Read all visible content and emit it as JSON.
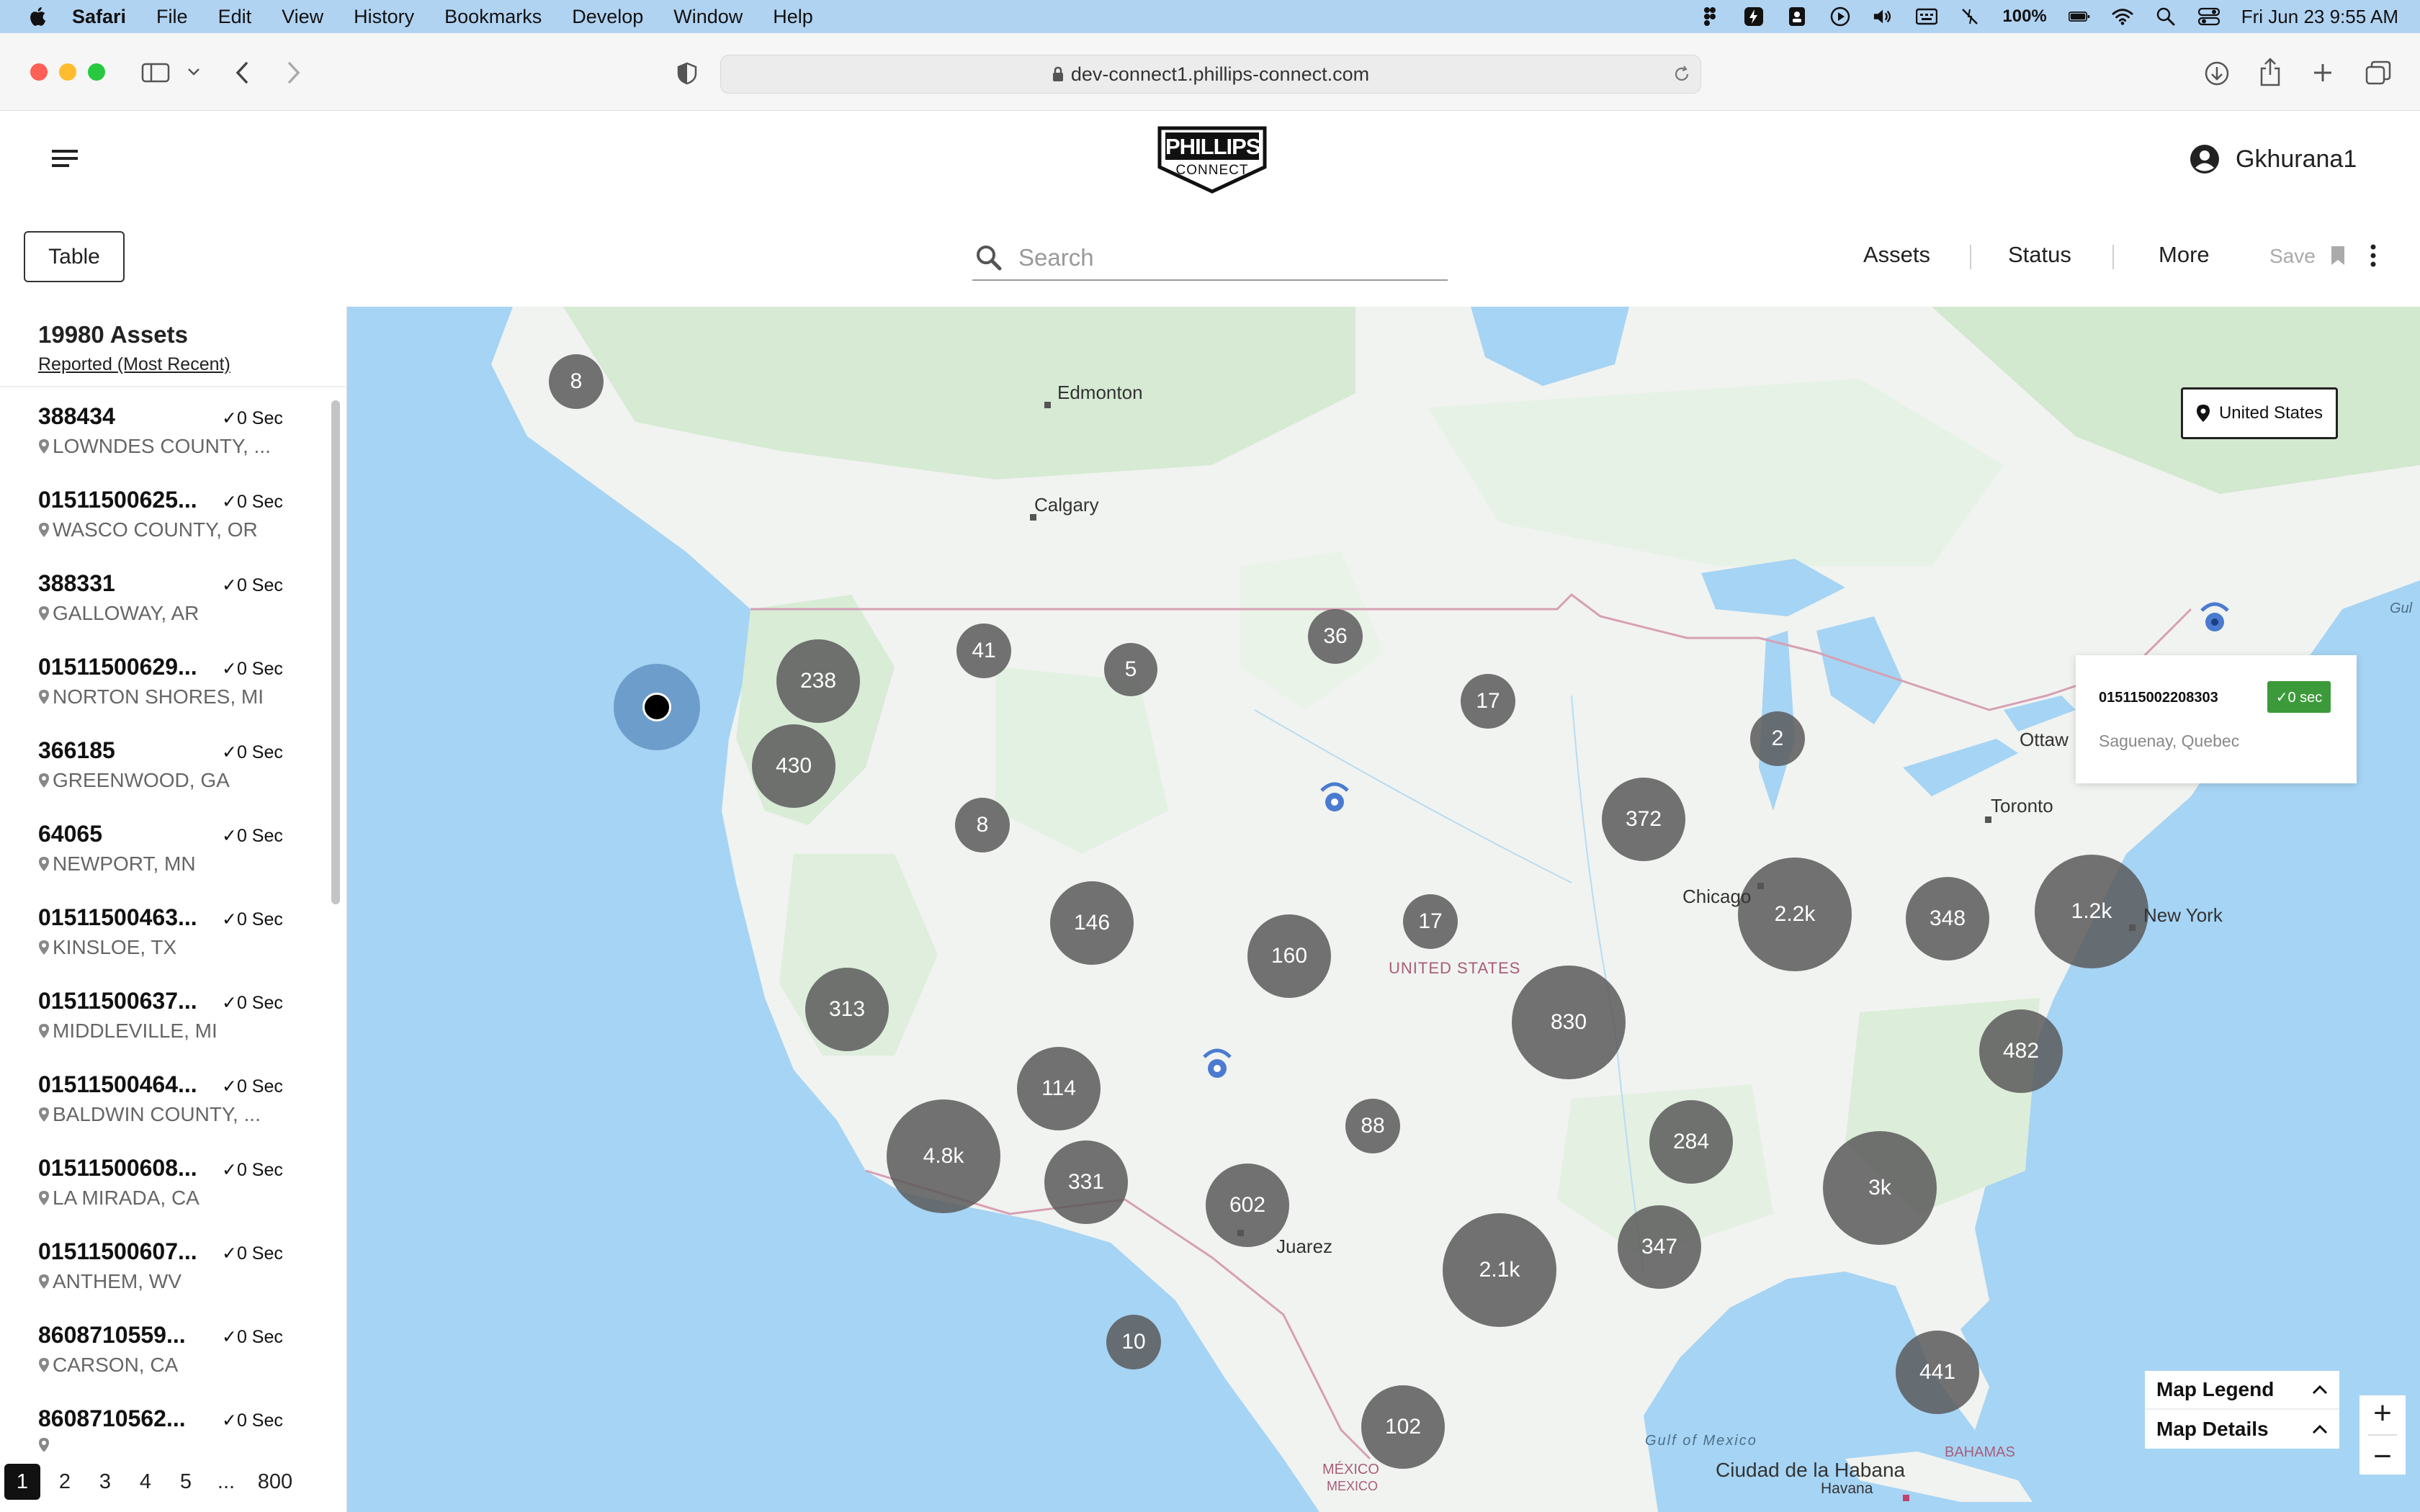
{
  "menubar": {
    "app": "Safari",
    "items": [
      "File",
      "Edit",
      "View",
      "History",
      "Bookmarks",
      "Develop",
      "Window",
      "Help"
    ],
    "battery": "100%",
    "datetime": "Fri Jun 23  9:55 AM"
  },
  "browser": {
    "url": "dev-connect1.phillips-connect.com"
  },
  "header": {
    "logo_top": "PHILLIPS",
    "logo_bottom": "CONNECT",
    "username": "Gkhurana1"
  },
  "toolbar": {
    "table_label": "Table",
    "search_placeholder": "Search",
    "tabs": [
      "Assets",
      "Status",
      "More"
    ],
    "save_label": "Save"
  },
  "sidebar": {
    "count_label": "19980 Assets",
    "sort_label": "Reported (Most Recent)",
    "assets": [
      {
        "id": "388434",
        "status": "✓0 Sec",
        "location": "LOWNDES COUNTY, ..."
      },
      {
        "id": "01511500625...",
        "status": "✓0 Sec",
        "location": "WASCO COUNTY, OR"
      },
      {
        "id": "388331",
        "status": "✓0 Sec",
        "location": "GALLOWAY, AR"
      },
      {
        "id": "01511500629...",
        "status": "✓0 Sec",
        "location": "NORTON SHORES, MI"
      },
      {
        "id": "366185",
        "status": "✓0 Sec",
        "location": "GREENWOOD, GA"
      },
      {
        "id": "64065",
        "status": "✓0 Sec",
        "location": "NEWPORT, MN"
      },
      {
        "id": "01511500463...",
        "status": "✓0 Sec",
        "location": "KINSLOE, TX"
      },
      {
        "id": "01511500637...",
        "status": "✓0 Sec",
        "location": "MIDDLEVILLE, MI"
      },
      {
        "id": "01511500464...",
        "status": "✓0 Sec",
        "location": "BALDWIN COUNTY, ..."
      },
      {
        "id": "01511500608...",
        "status": "✓0 Sec",
        "location": "LA MIRADA, CA"
      },
      {
        "id": "01511500607...",
        "status": "✓0 Sec",
        "location": "ANTHEM, WV"
      },
      {
        "id": "8608710559...",
        "status": "✓0 Sec",
        "location": "CARSON, CA"
      },
      {
        "id": "8608710562...",
        "status": "✓0 Sec",
        "location": ""
      }
    ],
    "pages": [
      "1",
      "2",
      "3",
      "4",
      "5",
      "...",
      "800"
    ]
  },
  "map": {
    "region_button": "United States",
    "clusters": [
      "8",
      "41",
      "5",
      "36",
      "17",
      "238",
      "430",
      "8",
      "2",
      "372",
      "146",
      "160",
      "17",
      "2.2k",
      "348",
      "1.2k",
      "313",
      "830",
      "114",
      "482",
      "4.8k",
      "88",
      "284",
      "331",
      "602",
      "3k",
      "347",
      "2.1k",
      "10",
      "441",
      "102"
    ],
    "cities": [
      "Edmonton",
      "Calgary",
      "Toronto",
      "Chicago",
      "New York",
      "Ottaw",
      "Juarez",
      "Ciudad de la Habana",
      "Havana"
    ],
    "labels": {
      "country_us": "UNITED STATES",
      "mexico": "MÉXICO",
      "mexico_sub": "MEXICO",
      "bahamas": "BAHAMAS",
      "gulf": "Gulf of Mexico",
      "gulf_edge": "Gul"
    },
    "popup": {
      "asset_id": "015115002208303",
      "status": "✓0 sec",
      "location": "Saguenay, Quebec"
    },
    "legend_label": "Map Legend",
    "details_label": "Map Details",
    "zoom_in": "+",
    "zoom_out": "−"
  }
}
